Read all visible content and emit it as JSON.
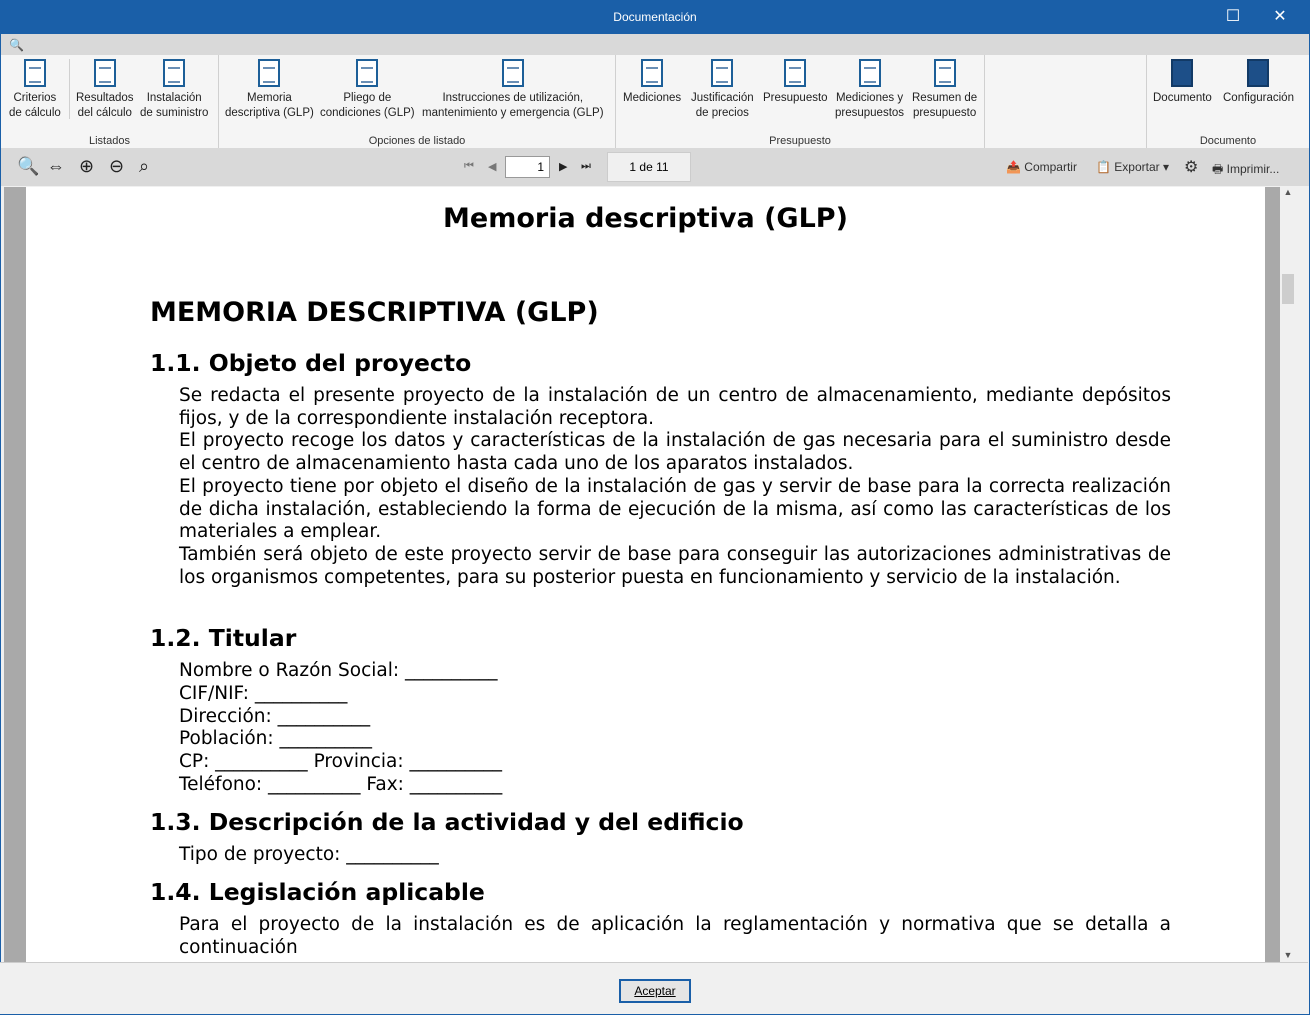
{
  "window": {
    "title": "Documentación",
    "maximize": "☐",
    "close": "✕"
  },
  "search_icon": "🔍",
  "ribbon": {
    "groups": [
      {
        "label": "Listados",
        "buttons": [
          [
            "Criterios",
            "de cálculo"
          ],
          [
            "Resultados",
            "del cálculo"
          ],
          [
            "Instalación",
            "de suministro"
          ]
        ]
      },
      {
        "label": "Opciones de listado",
        "buttons": [
          [
            "Memoria",
            "descriptiva (GLP)"
          ],
          [
            "Pliego de",
            "condiciones (GLP)"
          ],
          [
            "Instrucciones de utilización,",
            "mantenimiento y emergencia (GLP)"
          ]
        ]
      },
      {
        "label": "Presupuesto",
        "buttons": [
          [
            "Mediciones",
            ""
          ],
          [
            "Justificación",
            "de precios"
          ],
          [
            "Presupuesto",
            ""
          ],
          [
            "Mediciones y",
            "presupuestos"
          ],
          [
            "Resumen de",
            "presupuesto"
          ]
        ]
      },
      {
        "label": "Documento",
        "buttons": [
          [
            "Documento",
            ""
          ],
          [
            "Configuración",
            ""
          ]
        ]
      }
    ]
  },
  "toolbar": {
    "page": "1",
    "page_count": "1 de 11",
    "share": "Compartir",
    "export": "Exportar",
    "print": "Imprimir..."
  },
  "document": {
    "title": "Memoria descriptiva (GLP)",
    "h1": "MEMORIA DESCRIPTIVA (GLP)",
    "s1": {
      "heading": "1.1. Objeto del proyecto",
      "paras": [
        "Se redacta el presente proyecto de la instalación de un centro de almacenamiento, mediante depósitos fijos, y de la correspondiente instalación receptora.",
        "El proyecto recoge los datos y características de la instalación de gas necesaria para el suministro desde el centro de almacenamiento hasta cada uno de los aparatos instalados.",
        "El proyecto tiene por objeto el diseño de la instalación de gas y servir de base para la correcta realización de dicha instalación, estableciendo la forma de ejecución de la misma, así como las características de los materiales a emplear.",
        "También será objeto de este proyecto servir de base para conseguir las autorizaciones administrativas de los organismos competentes, para su posterior puesta en funcionamiento y servicio de la instalación."
      ]
    },
    "s2": {
      "heading": "1.2. Titular",
      "lines": [
        "Nombre o Razón Social: __________",
        "CIF/NIF: __________",
        "Dirección: __________",
        "Población: __________",
        "CP: __________ Provincia: __________",
        "Teléfono: __________ Fax: __________"
      ]
    },
    "s3": {
      "heading": "1.3. Descripción de la actividad y del edificio",
      "lines": [
        "Tipo de proyecto: __________"
      ]
    },
    "s4": {
      "heading": "1.4. Legislación aplicable",
      "para": "Para el proyecto de la instalación es de aplicación la reglamentación y normativa que se detalla a continuación"
    }
  },
  "footer": {
    "accept": "Aceptar"
  }
}
